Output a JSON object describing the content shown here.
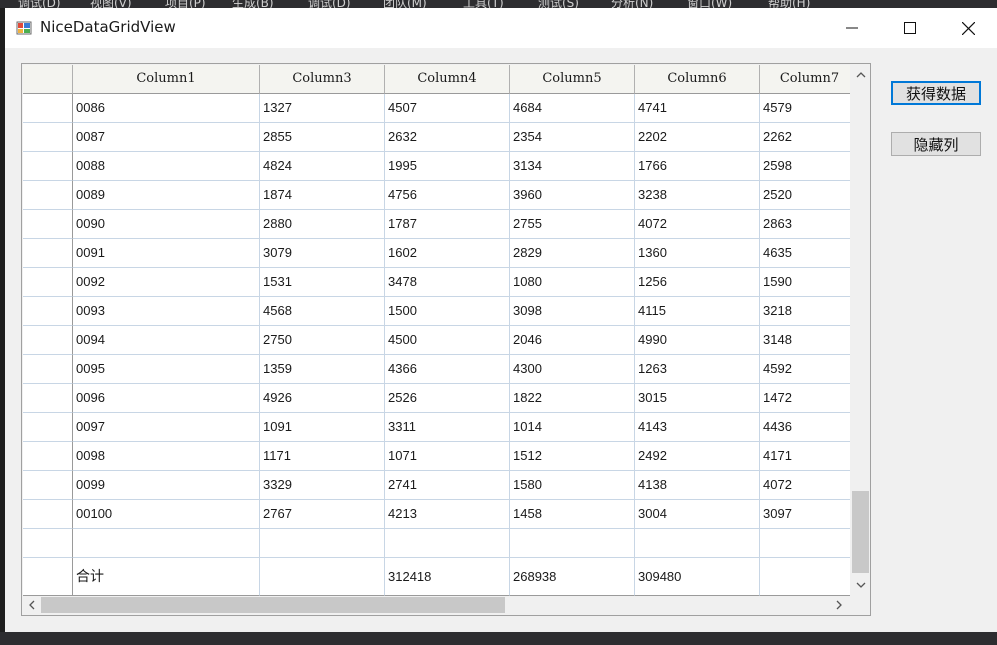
{
  "ide_menu": [
    "调试(D)",
    "视图(V)",
    "项目(P)",
    "生成(B)",
    "调试(D)",
    "团队(M)",
    "工具(T)",
    "测试(S)",
    "分析(N)",
    "窗口(W)",
    "帮助(H)"
  ],
  "window": {
    "title": "NiceDataGridView",
    "minimize_icon": "minimize-icon",
    "maximize_icon": "maximize-icon",
    "close_icon": "close-icon"
  },
  "grid": {
    "columns": [
      "Column1",
      "Column3",
      "Column4",
      "Column5",
      "Column6",
      "Column7"
    ],
    "rows": [
      [
        "0086",
        "1327",
        "4507",
        "4684",
        "4741",
        "4579"
      ],
      [
        "0087",
        "2855",
        "2632",
        "2354",
        "2202",
        "2262"
      ],
      [
        "0088",
        "4824",
        "1995",
        "3134",
        "1766",
        "2598"
      ],
      [
        "0089",
        "1874",
        "4756",
        "3960",
        "3238",
        "2520"
      ],
      [
        "0090",
        "2880",
        "1787",
        "2755",
        "4072",
        "2863"
      ],
      [
        "0091",
        "3079",
        "1602",
        "2829",
        "1360",
        "4635"
      ],
      [
        "0092",
        "1531",
        "3478",
        "1080",
        "1256",
        "1590"
      ],
      [
        "0093",
        "4568",
        "1500",
        "3098",
        "4115",
        "3218"
      ],
      [
        "0094",
        "2750",
        "4500",
        "2046",
        "4990",
        "3148"
      ],
      [
        "0095",
        "1359",
        "4366",
        "4300",
        "1263",
        "4592"
      ],
      [
        "0096",
        "4926",
        "2526",
        "1822",
        "3015",
        "1472"
      ],
      [
        "0097",
        "1091",
        "3311",
        "1014",
        "4143",
        "4436"
      ],
      [
        "0098",
        "1171",
        "1071",
        "1512",
        "2492",
        "4171"
      ],
      [
        "0099",
        "3329",
        "2741",
        "1580",
        "4138",
        "4072"
      ],
      [
        "00100",
        "2767",
        "4213",
        "1458",
        "3004",
        "3097"
      ]
    ],
    "total_row": [
      "合计",
      "",
      "312418",
      "268938",
      "309480",
      ""
    ],
    "vertical_scroll_position": 0.85,
    "horizontal_scroll_position": 0.0
  },
  "buttons": {
    "get_data": "获得数据",
    "hide_column": "隐藏列"
  },
  "colors": {
    "grid_line": "#c8d6e5",
    "header_bg": "#f4f4f0",
    "accent": "#0078d7"
  }
}
